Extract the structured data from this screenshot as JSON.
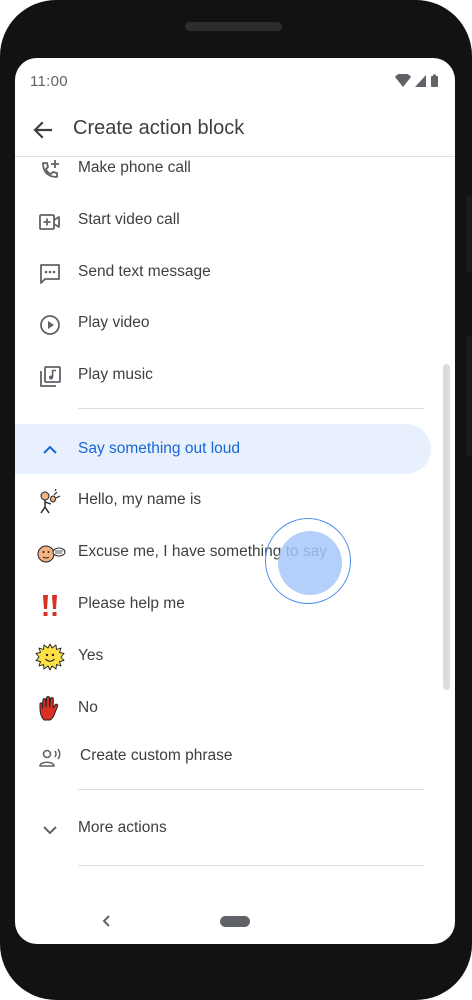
{
  "status_bar": {
    "time": "11:00"
  },
  "app_bar": {
    "title": "Create action block",
    "back_icon": "arrow-back-icon"
  },
  "actions": [
    {
      "label": "Make phone call",
      "icon": "add-call-icon"
    },
    {
      "label": "Start video call",
      "icon": "video-call-icon"
    },
    {
      "label": "Send text message",
      "icon": "sms-icon"
    },
    {
      "label": "Play video",
      "icon": "play-circle-icon"
    },
    {
      "label": "Play music",
      "icon": "library-music-icon"
    }
  ],
  "say_section": {
    "label": "Say something out loud",
    "expanded": true,
    "icon": "chevron-up-icon",
    "items": [
      {
        "label": "Hello, my name is",
        "icon": "hello-symbol-icon"
      },
      {
        "label": "Excuse me, I have something to say",
        "icon": "excuse-me-symbol-icon"
      },
      {
        "label": "Please help me",
        "icon": "exclamation-symbol-icon"
      },
      {
        "label": "Yes",
        "icon": "smiley-sun-symbol-icon"
      },
      {
        "label": "No",
        "icon": "red-hand-symbol-icon"
      },
      {
        "label": "Create custom phrase",
        "icon": "record-voice-icon"
      }
    ]
  },
  "more_actions": {
    "label": "More actions",
    "icon": "chevron-down-icon"
  },
  "colors": {
    "accent": "#1967d2",
    "section_highlight": "#e8f0fe",
    "text": "#3c4043",
    "icon": "#5f6368",
    "touch_indicator": "#a8c7fa"
  }
}
